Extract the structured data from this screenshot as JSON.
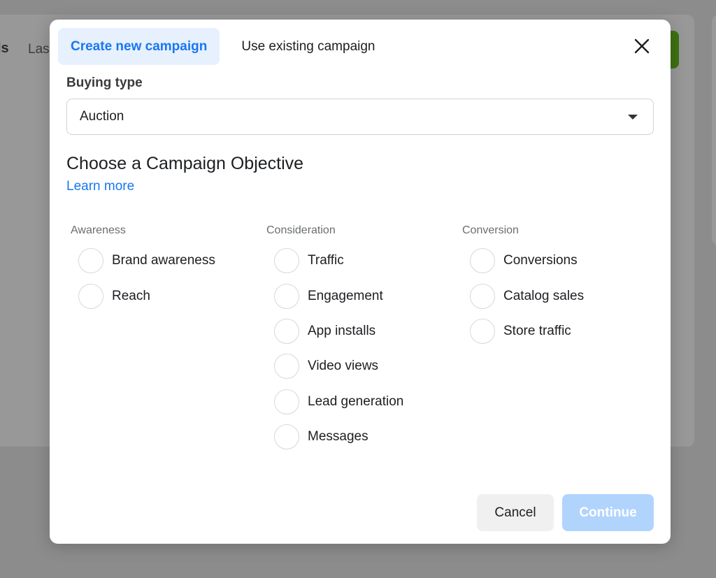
{
  "background": {
    "title_fragment": "ls",
    "subtitle_fragment": "Las"
  },
  "modal": {
    "tabs": [
      {
        "label": "Create new campaign",
        "active": true
      },
      {
        "label": "Use existing campaign",
        "active": false
      }
    ],
    "close_icon": "close-icon",
    "buying_type": {
      "label": "Buying type",
      "value": "Auction",
      "icon": "caret-down-icon"
    },
    "objective": {
      "heading": "Choose a Campaign Objective",
      "learn_more": "Learn more"
    },
    "columns": [
      {
        "label": "Awareness",
        "options": [
          "Brand awareness",
          "Reach"
        ]
      },
      {
        "label": "Consideration",
        "options": [
          "Traffic",
          "Engagement",
          "App installs",
          "Video views",
          "Lead generation",
          "Messages"
        ]
      },
      {
        "label": "Conversion",
        "options": [
          "Conversions",
          "Catalog sales",
          "Store traffic"
        ]
      }
    ],
    "footer": {
      "cancel_label": "Cancel",
      "continue_label": "Continue",
      "continue_enabled": false
    }
  },
  "colors": {
    "accent": "#1877f2",
    "active_tab_bg": "#e7f0fd",
    "continue_disabled_bg": "#b1d4fd",
    "background_green_button": "#3e7112"
  }
}
